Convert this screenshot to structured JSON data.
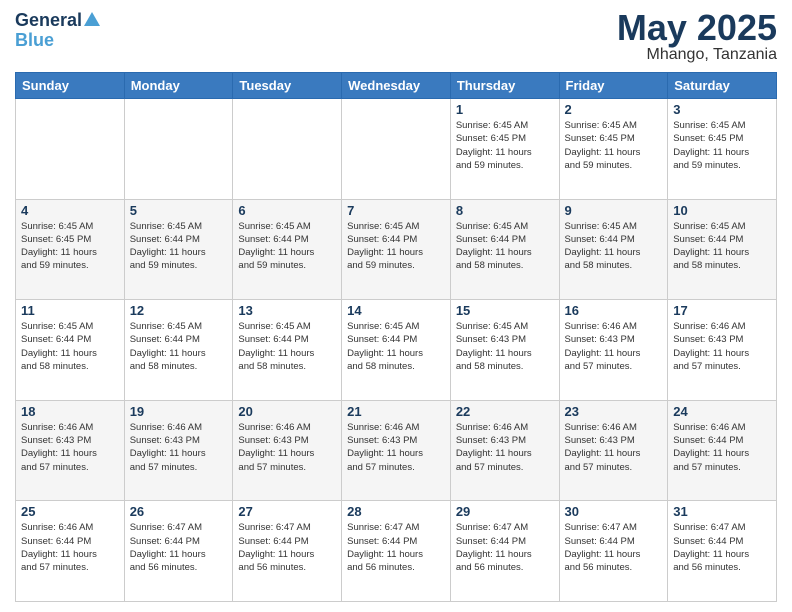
{
  "header": {
    "logo_general": "General",
    "logo_blue": "Blue",
    "month_title": "May 2025",
    "location": "Mhango, Tanzania"
  },
  "days_of_week": [
    "Sunday",
    "Monday",
    "Tuesday",
    "Wednesday",
    "Thursday",
    "Friday",
    "Saturday"
  ],
  "weeks": [
    [
      {
        "day": "",
        "info": ""
      },
      {
        "day": "",
        "info": ""
      },
      {
        "day": "",
        "info": ""
      },
      {
        "day": "",
        "info": ""
      },
      {
        "day": "1",
        "info": "Sunrise: 6:45 AM\nSunset: 6:45 PM\nDaylight: 11 hours\nand 59 minutes."
      },
      {
        "day": "2",
        "info": "Sunrise: 6:45 AM\nSunset: 6:45 PM\nDaylight: 11 hours\nand 59 minutes."
      },
      {
        "day": "3",
        "info": "Sunrise: 6:45 AM\nSunset: 6:45 PM\nDaylight: 11 hours\nand 59 minutes."
      }
    ],
    [
      {
        "day": "4",
        "info": "Sunrise: 6:45 AM\nSunset: 6:45 PM\nDaylight: 11 hours\nand 59 minutes."
      },
      {
        "day": "5",
        "info": "Sunrise: 6:45 AM\nSunset: 6:44 PM\nDaylight: 11 hours\nand 59 minutes."
      },
      {
        "day": "6",
        "info": "Sunrise: 6:45 AM\nSunset: 6:44 PM\nDaylight: 11 hours\nand 59 minutes."
      },
      {
        "day": "7",
        "info": "Sunrise: 6:45 AM\nSunset: 6:44 PM\nDaylight: 11 hours\nand 59 minutes."
      },
      {
        "day": "8",
        "info": "Sunrise: 6:45 AM\nSunset: 6:44 PM\nDaylight: 11 hours\nand 58 minutes."
      },
      {
        "day": "9",
        "info": "Sunrise: 6:45 AM\nSunset: 6:44 PM\nDaylight: 11 hours\nand 58 minutes."
      },
      {
        "day": "10",
        "info": "Sunrise: 6:45 AM\nSunset: 6:44 PM\nDaylight: 11 hours\nand 58 minutes."
      }
    ],
    [
      {
        "day": "11",
        "info": "Sunrise: 6:45 AM\nSunset: 6:44 PM\nDaylight: 11 hours\nand 58 minutes."
      },
      {
        "day": "12",
        "info": "Sunrise: 6:45 AM\nSunset: 6:44 PM\nDaylight: 11 hours\nand 58 minutes."
      },
      {
        "day": "13",
        "info": "Sunrise: 6:45 AM\nSunset: 6:44 PM\nDaylight: 11 hours\nand 58 minutes."
      },
      {
        "day": "14",
        "info": "Sunrise: 6:45 AM\nSunset: 6:44 PM\nDaylight: 11 hours\nand 58 minutes."
      },
      {
        "day": "15",
        "info": "Sunrise: 6:45 AM\nSunset: 6:43 PM\nDaylight: 11 hours\nand 58 minutes."
      },
      {
        "day": "16",
        "info": "Sunrise: 6:46 AM\nSunset: 6:43 PM\nDaylight: 11 hours\nand 57 minutes."
      },
      {
        "day": "17",
        "info": "Sunrise: 6:46 AM\nSunset: 6:43 PM\nDaylight: 11 hours\nand 57 minutes."
      }
    ],
    [
      {
        "day": "18",
        "info": "Sunrise: 6:46 AM\nSunset: 6:43 PM\nDaylight: 11 hours\nand 57 minutes."
      },
      {
        "day": "19",
        "info": "Sunrise: 6:46 AM\nSunset: 6:43 PM\nDaylight: 11 hours\nand 57 minutes."
      },
      {
        "day": "20",
        "info": "Sunrise: 6:46 AM\nSunset: 6:43 PM\nDaylight: 11 hours\nand 57 minutes."
      },
      {
        "day": "21",
        "info": "Sunrise: 6:46 AM\nSunset: 6:43 PM\nDaylight: 11 hours\nand 57 minutes."
      },
      {
        "day": "22",
        "info": "Sunrise: 6:46 AM\nSunset: 6:43 PM\nDaylight: 11 hours\nand 57 minutes."
      },
      {
        "day": "23",
        "info": "Sunrise: 6:46 AM\nSunset: 6:43 PM\nDaylight: 11 hours\nand 57 minutes."
      },
      {
        "day": "24",
        "info": "Sunrise: 6:46 AM\nSunset: 6:44 PM\nDaylight: 11 hours\nand 57 minutes."
      }
    ],
    [
      {
        "day": "25",
        "info": "Sunrise: 6:46 AM\nSunset: 6:44 PM\nDaylight: 11 hours\nand 57 minutes."
      },
      {
        "day": "26",
        "info": "Sunrise: 6:47 AM\nSunset: 6:44 PM\nDaylight: 11 hours\nand 56 minutes."
      },
      {
        "day": "27",
        "info": "Sunrise: 6:47 AM\nSunset: 6:44 PM\nDaylight: 11 hours\nand 56 minutes."
      },
      {
        "day": "28",
        "info": "Sunrise: 6:47 AM\nSunset: 6:44 PM\nDaylight: 11 hours\nand 56 minutes."
      },
      {
        "day": "29",
        "info": "Sunrise: 6:47 AM\nSunset: 6:44 PM\nDaylight: 11 hours\nand 56 minutes."
      },
      {
        "day": "30",
        "info": "Sunrise: 6:47 AM\nSunset: 6:44 PM\nDaylight: 11 hours\nand 56 minutes."
      },
      {
        "day": "31",
        "info": "Sunrise: 6:47 AM\nSunset: 6:44 PM\nDaylight: 11 hours\nand 56 minutes."
      }
    ]
  ]
}
